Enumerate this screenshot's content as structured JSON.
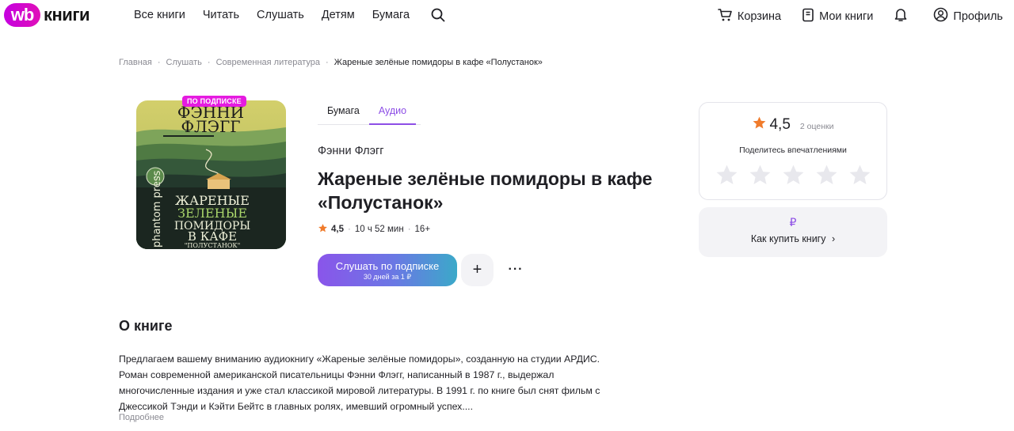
{
  "brand": {
    "wb": "wb",
    "name": "книги"
  },
  "nav": {
    "items": [
      "Все книги",
      "Читать",
      "Слушать",
      "Детям",
      "Бумага"
    ]
  },
  "header_right": {
    "cart": "Корзина",
    "my_books": "Мои книги",
    "profile": "Профиль"
  },
  "breadcrumb": [
    "Главная",
    "Слушать",
    "Современная литература",
    "Жареные зелёные помидоры в кафе «Полустанок»"
  ],
  "cover": {
    "badge": "ПО ПОДПИСКЕ",
    "author_line1": "ФЭННИ",
    "author_line2": "ФЛЭГГ",
    "title_lines": [
      "ЖАРЕНЫЕ",
      "ЗЕЛЕНЫЕ",
      "ПОМИДОРЫ",
      "В КАФЕ",
      "\"ПОЛУСТАНОК\""
    ],
    "publisher": "phantom press",
    "colors": {
      "sky": "#c9c766",
      "hill_light": "#6e9b52",
      "hill_dark": "#2e4a2c",
      "ground": "#1d2a23"
    }
  },
  "formats": {
    "tabs": [
      "Бумага",
      "Аудио"
    ],
    "active": "Аудио"
  },
  "book": {
    "author": "Фэнни Флэгг",
    "title": "Жареные зелёные помидоры в кафе «Полустанок»",
    "rating": "4,5",
    "duration": "10 ч 52 мин",
    "age": "16+"
  },
  "actions": {
    "listen_label": "Слушать по подписке",
    "listen_sub": "30 дней за 1 ₽",
    "add": "+",
    "more": "···"
  },
  "rating_card": {
    "score": "4,5",
    "count": "2 оценки",
    "share": "Поделитесь впечатлениями",
    "stars": 5,
    "star_color": "#f07b2b",
    "empty_star_color": "#e8e8ed"
  },
  "buy_card": {
    "currency": "₽",
    "label": "Как купить книгу",
    "chevron": "›"
  },
  "about": {
    "title": "О книге",
    "text": "Предлагаем вашему вниманию аудиокнигу «Жареные зелёные помидоры», созданную на студии АРДИС. Роман современной американской писательницы Фэнни Флэгг, написанный в 1987 г., выдержал многочисленные издания и уже стал классикой мировой литературы. В 1991 г. по книге был снят фильм с Джессикой Тэнди и Кэйти Бейтс в главных ролях, имевший огромный успех....",
    "more": "Подробнее"
  },
  "colors": {
    "accent": "#8d4ee6",
    "brand": "#cf0ad4",
    "text": "#1f1f24",
    "muted": "#8a8a92"
  }
}
